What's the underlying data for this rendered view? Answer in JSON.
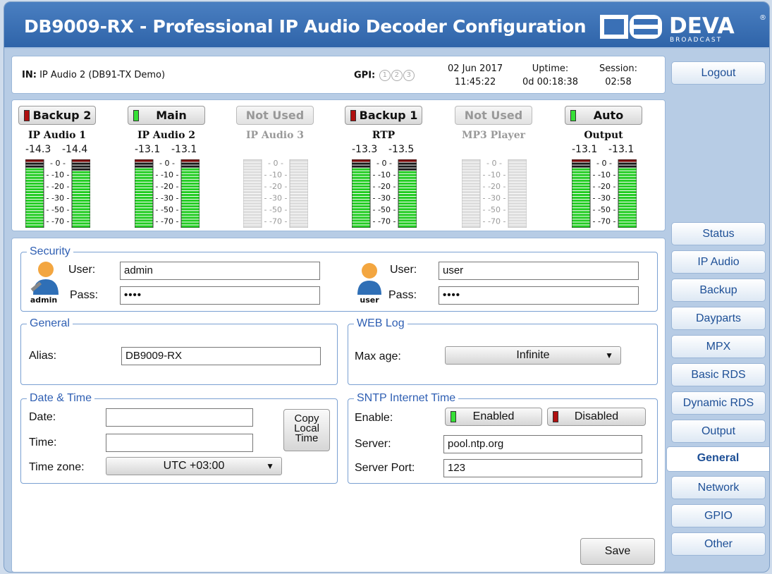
{
  "header": {
    "title": "DB9009-RX - Professional IP Audio Decoder Configuration",
    "logo_text": "DEVA",
    "logo_sub": "BROADCAST"
  },
  "status": {
    "in_label": "IN:",
    "in_value": "IP Audio 2 (DB91-TX Demo)",
    "gpi_label": "GPI:",
    "gpi": [
      "1",
      "2",
      "3"
    ],
    "date": "02 Jun 2017",
    "time": "11:45:22",
    "uptime_label": "Uptime:",
    "uptime": "0d 00:18:38",
    "session_label": "Session:",
    "session": "02:58"
  },
  "meters": [
    {
      "button": "Backup 2",
      "led": "red",
      "name": "IP Audio 1",
      "left": "-14.3",
      "right": "-14.4",
      "active": true,
      "level_l": 0.88,
      "level_r": 0.86
    },
    {
      "button": "Main",
      "led": "green",
      "name": "IP Audio 2",
      "left": "-13.1",
      "right": "-13.1",
      "active": true,
      "level_l": 0.88,
      "level_r": 0.88
    },
    {
      "button": "Not Used",
      "led": "",
      "name": "IP Audio 3",
      "left": "",
      "right": "",
      "active": false,
      "level_l": 0,
      "level_r": 0
    },
    {
      "button": "Backup 1",
      "led": "red",
      "name": "RTP",
      "left": "-13.3",
      "right": "-13.5",
      "active": true,
      "level_l": 0.88,
      "level_r": 0.86
    },
    {
      "button": "Not Used",
      "led": "",
      "name": "MP3 Player",
      "left": "",
      "right": "",
      "active": false,
      "level_l": 0,
      "level_r": 0
    },
    {
      "button": "Auto",
      "led": "green",
      "name": "Output",
      "left": "-13.1",
      "right": "-13.1",
      "active": true,
      "level_l": 0.88,
      "level_r": 0.88
    }
  ],
  "meter_scale": [
    "0",
    "-10",
    "-20",
    "-30",
    "-50",
    "-70"
  ],
  "sidebar": {
    "logout": "Logout",
    "items": [
      "Status",
      "IP Audio",
      "Backup",
      "Dayparts",
      "MPX",
      "Basic RDS",
      "Dynamic RDS",
      "Output",
      "General",
      "Network",
      "GPIO",
      "Other"
    ],
    "active": "General"
  },
  "security": {
    "legend": "Security",
    "admin": {
      "icon_label": "admin",
      "user_label": "User:",
      "user": "admin",
      "pass_label": "Pass:",
      "pass": "••••"
    },
    "user": {
      "icon_label": "user",
      "user_label": "User:",
      "user": "user",
      "pass_label": "Pass:",
      "pass": "••••"
    }
  },
  "general": {
    "legend": "General",
    "alias_label": "Alias:",
    "alias": "DB9009-RX"
  },
  "weblog": {
    "legend": "WEB Log",
    "maxage_label": "Max age:",
    "maxage": "Infinite"
  },
  "datetime": {
    "legend": "Date & Time",
    "date_label": "Date:",
    "date": "",
    "time_label": "Time:",
    "time": "",
    "tz_label": "Time zone:",
    "tz": "UTC +03:00",
    "copy_button": "Copy Local Time"
  },
  "sntp": {
    "legend": "SNTP Internet Time",
    "enable_label": "Enable:",
    "enabled": "Enabled",
    "disabled": "Disabled",
    "server_label": "Server:",
    "server": "pool.ntp.org",
    "port_label": "Server Port:",
    "port": "123"
  },
  "save": "Save",
  "colors": {
    "header": "#3a70b6",
    "accent": "#1d4f96",
    "legend": "#2f5fb3",
    "meter_green": "#22cc22",
    "meter_dark": "#1a1a1a",
    "meter_red": "#7a0000"
  }
}
